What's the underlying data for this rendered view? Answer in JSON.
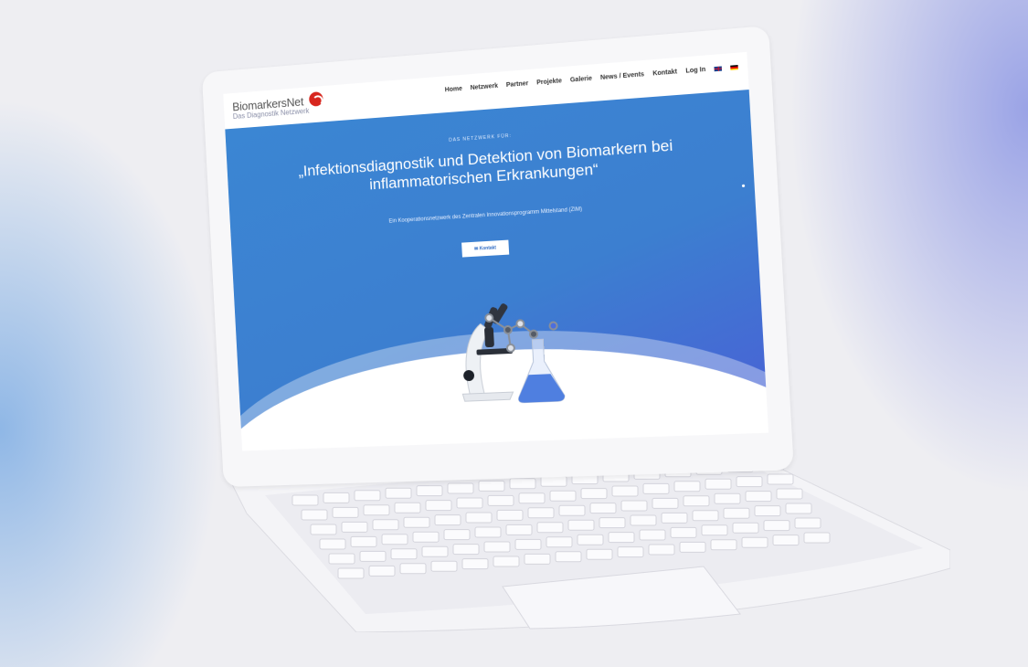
{
  "site": {
    "logo_name": "BiomarkersNet",
    "logo_sub": "Das Diagnostik Netzwerk",
    "nav": [
      "Home",
      "Netzwerk",
      "Partner",
      "Projekte",
      "Galerie",
      "News / Events",
      "Kontakt",
      "Log In"
    ],
    "hero": {
      "kicker": "DAS NETZWERK FÜR:",
      "headline": "„Infektionsdiagnostik und Detektion von Biomarkern bei inflammatorischen Erkrankungen“",
      "subline": "Ein Kooperationsnetzwerk des Zentralen Innovationsprogramm Mittelstand (ZIM)",
      "cta_label": "✉ Kontakt"
    }
  },
  "icons": [
    "flag-uk-icon",
    "flag-de-icon",
    "logo-mark-icon",
    "microscope-illustration",
    "flask-illustration"
  ],
  "colors": {
    "hero_top": "#3b86d3",
    "hero_bottom": "#4a5fd6",
    "logo_red": "#d7261e"
  }
}
